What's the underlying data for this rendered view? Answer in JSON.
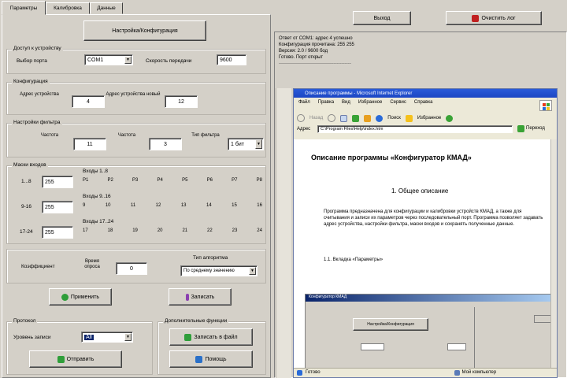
{
  "tabs": [
    "Параметры",
    "Калибровка",
    "Данные"
  ],
  "header_button": "Настройка/Конфигурация",
  "port_group": {
    "title": "Доступ к устройству",
    "port_label": "Выбор порта",
    "port_value": "COM1",
    "speed_label": "Скорость передачи",
    "speed_value": "9600"
  },
  "config_group": {
    "title": "Конфигурация",
    "addr_label": "Адрес устройства",
    "addr_value": "4",
    "addr2_label": "Адрес устройства новый",
    "addr2_value": "12"
  },
  "filter_group": {
    "title": "Настройки фильтра",
    "f1_label": "Частота",
    "f1_value": "11",
    "f2_label": "Частота",
    "f2_value": "3",
    "f3_label": "Тип фильтра",
    "f3_value": "1 бит"
  },
  "bits_group": {
    "title": "Маски входов",
    "rows": [
      {
        "label": "1...8",
        "value": "255",
        "caption": "Входы 1..8",
        "bits": [
          "P1",
          "P2",
          "P3",
          "P4",
          "P5",
          "P6",
          "P7",
          "P8"
        ]
      },
      {
        "label": "9-16",
        "value": "255",
        "caption": "Входы 9..16",
        "bits": [
          "9",
          "10",
          "11",
          "12",
          "13",
          "14",
          "15",
          "16"
        ]
      },
      {
        "label": "17-24",
        "value": "255",
        "caption": "Входы 17..24",
        "bits": [
          "17",
          "18",
          "19",
          "20",
          "21",
          "22",
          "23",
          "24"
        ]
      }
    ]
  },
  "coef_group": {
    "label": "Коэффициент",
    "value_label": "Время опроса",
    "value": "0",
    "combo_label": "Тип алгоритма",
    "combo_value": "По среднему значению"
  },
  "actions": {
    "apply_label": "Применить",
    "write_label": "Записать"
  },
  "bottom_left": {
    "title": "Протокол",
    "combo_label": "Уровень записи",
    "combo_value": "All",
    "check_label": "Отправить"
  },
  "bottom_right": {
    "title": "Дополнительные функции",
    "save_label": "Записать в файл",
    "help_label": "Помощь"
  },
  "right_panel": {
    "exit_label": "Выход",
    "clear_label": "Очистить лог",
    "log_lines": [
      "Ответ от COM1: адрес 4 успешно",
      "Конфигурация прочитана: 255 255",
      "Версия: 2.0 / 9600 бод",
      "Готово. Порт открыт",
      "----------------------------------------------"
    ]
  },
  "browser": {
    "title": "Описание программы - Microsoft Internet Explorer",
    "menu": [
      "Файл",
      "Правка",
      "Вид",
      "Избранное",
      "Сервис",
      "Справка"
    ],
    "toolbar": [
      "Назад",
      "Поиск",
      "Избранное"
    ],
    "address_label": "Адрес",
    "address_value": "C:\\Program Files\\Help\\index.htm",
    "go_label": "Переход",
    "heading": "Описание программы «Конфигуратор КМАД»",
    "subheading": "1. Общее описание",
    "paragraph": "Программа предназначена для конфигурации и калибровки устройств КМАД, а также для считывания и записи их параметров через последовательный порт. Программа позволяет задавать адрес устройства, настройки фильтра, маски входов и сохранять полученные данные.",
    "section": "1.1. Вкладка «Параметры»",
    "inner_title": "Конфигуратор КМАД",
    "inner_button": "Настройка/Конфигурация",
    "status_done": "Готово",
    "status_zone": "Мой компьютер"
  },
  "colors": {
    "xp_blue": "#2a5bd8",
    "desktop_gray": "#d4d0c8"
  }
}
